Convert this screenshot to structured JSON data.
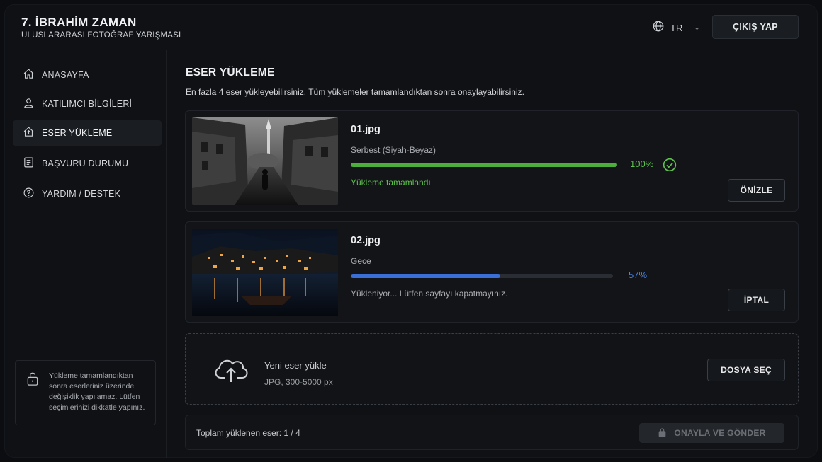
{
  "header": {
    "title": "7.  İBRAHİM ZAMAN",
    "subtitle": "ULUSLARARASI FOTOĞRAF YARIŞMASI",
    "language": "TR",
    "logout_label": "ÇIKIŞ YAP"
  },
  "sidebar": {
    "items": [
      {
        "label": "ANASAYFA",
        "icon": "home-icon"
      },
      {
        "label": "KATILIMCI BİLGİLERİ",
        "icon": "user-icon"
      },
      {
        "label": "ESER YÜKLEME",
        "icon": "upload-icon",
        "active": true
      },
      {
        "label": "BAŞVURU DURUMU",
        "icon": "list-icon"
      },
      {
        "label": "YARDIM / DESTEK",
        "icon": "help-icon"
      }
    ],
    "note": "Yükleme tamamlandıktan sonra eserleriniz üzerinde değişiklik yapılamaz. Lütfen seçimlerinizi dikkatle yapınız."
  },
  "main": {
    "title": "ESER YÜKLEME",
    "description": "En fazla 4 eser yükleyebilirsiniz. Tüm yüklemeler tamamlandıktan sonra onaylayabilirsiniz.",
    "uploads": [
      {
        "filename": "01.jpg",
        "category": "Serbest (Siyah-Beyaz)",
        "progress": 100,
        "progress_label": "100%",
        "status": "Yükleme tamamlandı",
        "action_label": "ÖNİZLE"
      },
      {
        "filename": "02.jpg",
        "category": "Gece",
        "progress": 57,
        "progress_label": "57%",
        "status": "Yükleniyor... Lütfen sayfayı kapatmayınız.",
        "action_label": "İPTAL"
      }
    ],
    "new_upload": {
      "title": "Yeni eser yükle",
      "hint": "JPG, 300-5000 px",
      "button_label": "DOSYA SEÇ"
    },
    "footer": {
      "count_text": "Toplam yüklenen eser: 1 / 4",
      "submit_label": "ONAYLA VE GÖNDER"
    }
  },
  "colors": {
    "success": "#4caf3c",
    "progress": "#3a6fd8",
    "background": "#0f1115"
  }
}
